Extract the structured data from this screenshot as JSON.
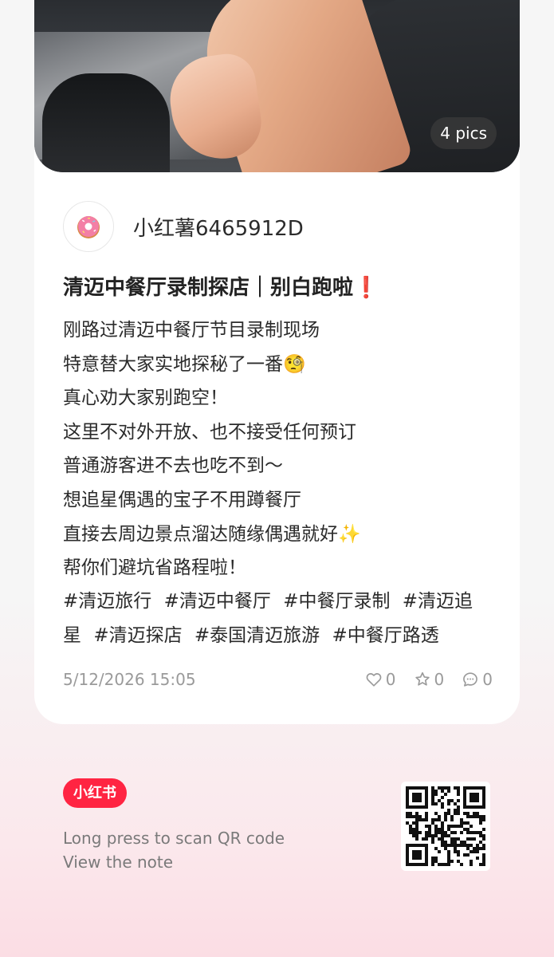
{
  "post": {
    "image_count_label": "4 pics",
    "author": {
      "name": "小红薯6465912D",
      "avatar_icon": "donut-icon"
    },
    "title": "清迈中餐厅录制探店｜别白跑啦❗️",
    "body_lines": [
      "刚路过清迈中餐厅节目录制现场",
      "特意替大家实地探秘了一番🧐",
      "真心劝大家别跑空！",
      "这里不对外开放、也不接受任何预订",
      "普通游客进不去也吃不到～",
      "想追星偶遇的宝子不用蹲餐厅",
      "直接去周边景点溜达随缘偶遇就好✨",
      "帮你们避坑省路程啦！"
    ],
    "tags": [
      "#清迈旅行",
      "#清迈中餐厅",
      "#中餐厅录制",
      "#清迈追星",
      "#清迈探店",
      "#泰国清迈旅游",
      "#中餐厅路透"
    ],
    "timestamp": "5/12/2026 15:05",
    "likes": "0",
    "collects": "0",
    "comments": "0"
  },
  "footer": {
    "brand_label": "小红书",
    "hint_line1": "Long press to scan QR code",
    "hint_line2": "View the note"
  },
  "colors": {
    "brand": "#ff2442",
    "text_primary": "#222222",
    "text_secondary": "#9a9a9a",
    "gradient_bottom": "#fbdde4"
  }
}
